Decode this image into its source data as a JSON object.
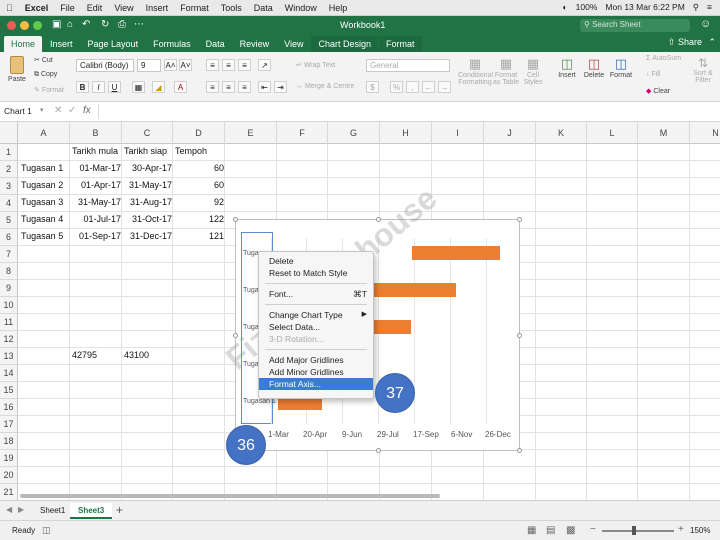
{
  "menubar": {
    "app": "Excel",
    "items": [
      "File",
      "Edit",
      "View",
      "Insert",
      "Format",
      "Tools",
      "Data",
      "Window",
      "Help"
    ],
    "battery": "100%",
    "datetime": "Mon 13 Mar 6:22 PM"
  },
  "titlebar": {
    "title": "Workbook1",
    "search_placeholder": "Search Sheet"
  },
  "tabs": [
    "Home",
    "Insert",
    "Page Layout",
    "Formulas",
    "Data",
    "Review",
    "View",
    "Chart Design",
    "Format"
  ],
  "share": "Share",
  "ribbon": {
    "paste": "Paste",
    "cut": "Cut",
    "copy": "Copy",
    "format_painter": "Format",
    "font": "Calibri (Body)",
    "size": "9",
    "bold": "B",
    "italic": "I",
    "underline": "U",
    "wrap": "Wrap Text",
    "merge": "Merge & Centre",
    "number_format": "General",
    "cond_format": "Conditional\nFormatting",
    "format_table": "Format\nas Table",
    "cell_styles": "Cell\nStyles",
    "insert": "Insert",
    "delete": "Delete",
    "format": "Format",
    "autosum": "AutoSum",
    "fill": "Fill",
    "clear": "Clear",
    "sort": "Sort &\nFilter"
  },
  "formula": {
    "namebox": "Chart 1",
    "fx": "fx",
    "value": ""
  },
  "columns": [
    "A",
    "B",
    "C",
    "D",
    "E",
    "F",
    "G",
    "H",
    "I",
    "J",
    "K",
    "L",
    "M",
    "N"
  ],
  "rows": [
    "1",
    "2",
    "3",
    "4",
    "5",
    "6",
    "7",
    "8",
    "9",
    "10",
    "11",
    "12",
    "13",
    "14",
    "15",
    "16",
    "17",
    "18",
    "19",
    "20",
    "21"
  ],
  "table": {
    "headers": [
      "Tarikh mula",
      "Tarikh siap",
      "Tempoh"
    ],
    "rows": [
      {
        "name": "Tugasan 1",
        "start": "01-Mar-17",
        "end": "30-Apr-17",
        "days": "60"
      },
      {
        "name": "Tugasan 2",
        "start": "01-Apr-17",
        "end": "31-May-17",
        "days": "60"
      },
      {
        "name": "Tugasan 3",
        "start": "31-May-17",
        "end": "31-Aug-17",
        "days": "92"
      },
      {
        "name": "Tugasan 4",
        "start": "01-Jul-17",
        "end": "31-Oct-17",
        "days": "122"
      },
      {
        "name": "Tugasan 5",
        "start": "01-Sep-17",
        "end": "31-Dec-17",
        "days": "121"
      }
    ],
    "b13": "42795",
    "c13": "43100"
  },
  "chart": {
    "x_ticks": [
      "1-Mar",
      "20-Apr",
      "9-Jun",
      "29-Jul",
      "17-Sep",
      "6-Nov",
      "26-Dec"
    ],
    "y_labels": [
      "Tugas",
      "Tugas",
      "Tugas",
      "Tugas",
      "Tugasan 1"
    ]
  },
  "context_menu": [
    {
      "label": "Delete",
      "shortcut": "",
      "disabled": false,
      "highlighted": false,
      "submenu": false
    },
    {
      "label": "Reset to Match Style",
      "shortcut": "",
      "disabled": false,
      "highlighted": false,
      "submenu": false
    },
    {
      "sep": true
    },
    {
      "label": "Font...",
      "shortcut": "⌘T",
      "disabled": false,
      "highlighted": false,
      "submenu": false
    },
    {
      "sep": true
    },
    {
      "label": "Change Chart Type",
      "shortcut": "",
      "disabled": false,
      "highlighted": false,
      "submenu": true
    },
    {
      "label": "Select Data...",
      "shortcut": "",
      "disabled": false,
      "highlighted": false,
      "submenu": false
    },
    {
      "label": "3-D Rotation...",
      "shortcut": "",
      "disabled": true,
      "highlighted": false,
      "submenu": false
    },
    {
      "sep": true
    },
    {
      "label": "Add Major Gridlines",
      "shortcut": "",
      "disabled": false,
      "highlighted": false,
      "submenu": false
    },
    {
      "label": "Add Minor Gridlines",
      "shortcut": "",
      "disabled": false,
      "highlighted": false,
      "submenu": false
    },
    {
      "label": "Format Axis...",
      "shortcut": "",
      "disabled": false,
      "highlighted": true,
      "submenu": false
    }
  ],
  "callouts": [
    "36",
    "37"
  ],
  "watermark": "Fizaaureduhouse",
  "sheets": [
    {
      "name": "Sheet1",
      "active": false
    },
    {
      "name": "Sheet3",
      "active": true
    }
  ],
  "status": {
    "ready": "Ready",
    "zoom": "150%"
  }
}
